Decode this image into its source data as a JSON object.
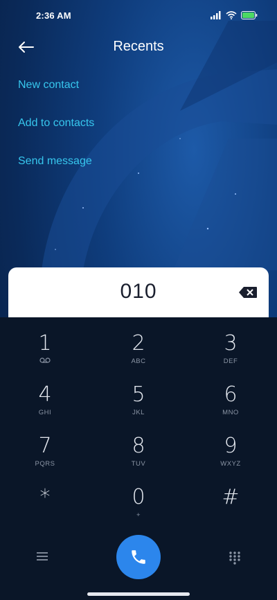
{
  "status_bar": {
    "time": "2:36 AM",
    "icons": [
      "signal-icon",
      "wifi-icon",
      "battery-icon"
    ]
  },
  "header": {
    "title": "Recents",
    "back_icon": "back-arrow-icon"
  },
  "actions": [
    "New contact",
    "Add to contacts",
    "Send message"
  ],
  "dialer": {
    "number": "010",
    "backspace_icon": "backspace-icon"
  },
  "keypad": [
    {
      "digit": "1",
      "letters": "",
      "sub_icon": "voicemail-icon"
    },
    {
      "digit": "2",
      "letters": "ABC"
    },
    {
      "digit": "3",
      "letters": "DEF"
    },
    {
      "digit": "4",
      "letters": "GHI"
    },
    {
      "digit": "5",
      "letters": "JKL"
    },
    {
      "digit": "6",
      "letters": "MNO"
    },
    {
      "digit": "7",
      "letters": "PQRS"
    },
    {
      "digit": "8",
      "letters": "TUV"
    },
    {
      "digit": "9",
      "letters": "WXYZ"
    },
    {
      "digit": "*",
      "letters": ""
    },
    {
      "digit": "0",
      "letters": "+"
    },
    {
      "digit": "#",
      "letters": ""
    }
  ],
  "bottom_bar": {
    "menu_icon": "menu-icon",
    "call_icon": "phone-icon",
    "dialpad_icon": "dialpad-icon"
  },
  "colors": {
    "accent": "#37c7ee",
    "call_button": "#2c86ec",
    "keypad_bg": "#0a1628"
  }
}
